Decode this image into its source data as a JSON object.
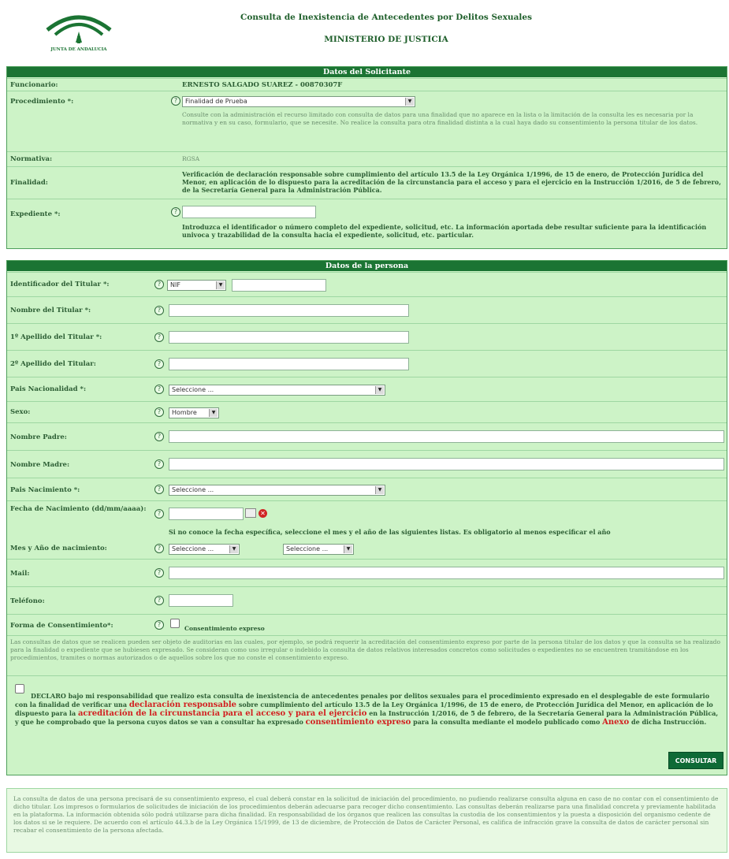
{
  "header": {
    "logo_text": "JUNTA DE ANDALUCIA",
    "title": "Consulta de Inexistencia de Antecedentes por Delitos Sexuales",
    "subtitle": "MINISTERIO DE JUSTICIA"
  },
  "solicitante": {
    "heading": "Datos del Solicitante",
    "funcionario_label": "Funcionario:",
    "funcionario_value": "ERNESTO SALGADO SUAREZ - 00870307F",
    "procedimiento_label": "Procedimiento *:",
    "procedimiento_value": "Finalidad de Prueba",
    "procedimiento_note": "Consulte con la administración el recurso limitado con consulta de datos para una finalidad que no aparece en la lista o la limitación de la consulta les es necesaria por la normativa y en su caso, formulario, que se necesite. No realice la consulta para otra finalidad distinta a la cual haya dado su consentimiento la persona titular de los datos.",
    "normativa_label": "Normativa:",
    "normativa_value": "RGSA",
    "finalidad_label": "Finalidad:",
    "finalidad_value": "Verificación de declaración responsable sobre cumplimiento del artículo 13.5 de la Ley Orgánica 1/1996, de 15 de enero, de Protección Jurídica del Menor, en aplicación de lo dispuesto para la acreditación de la circunstancia para el acceso y para el ejercicio en la Instrucción 1/2016, de 5 de febrero, de la Secretaría General para la Administración Pública.",
    "expediente_label": "Expediente *:",
    "expediente_value": "",
    "expediente_note": "Introduzca el identificador o número completo del expediente, solicitud, etc. La información aportada debe resultar suficiente para la identificación univoca y trazabilidad de la consulta hacia el expediente, solicitud, etc. particular."
  },
  "persona": {
    "heading": "Datos de la persona",
    "id_label": "Identificador del Titular *:",
    "id_type": "NIF",
    "nombre_label": "Nombre del Titular *:",
    "apellido1_label": "1º Apellido del Titular *:",
    "apellido2_label": "2º Apellido del Titular:",
    "pais_nac_label": "Pais Nacionalidad *:",
    "pais_nac_value": "Seleccione ...",
    "sexo_label": "Sexo:",
    "sexo_value": "Hombre",
    "padre_label": "Nombre Padre:",
    "madre_label": "Nombre Madre:",
    "pais_naci_label": "Pais Nacimiento *:",
    "pais_naci_value": "Seleccione ...",
    "fecha_label": "Fecha de Nacimiento (dd/mm/aaaa):",
    "fecha_note": "Si no conoce la fecha específica, seleccione el mes y el año de las siguientes listas. Es obligatorio al menos especificar el año",
    "mes_label": "Mes y Año de nacimiento:",
    "mes_value": "Seleccione ...",
    "anio_value": "Seleccione ...",
    "mail_label": "Mail:",
    "telefono_label": "Teléfono:",
    "forma_label": "Forma de Consentimiento*:",
    "forma_option": "Consentimiento expreso",
    "audit_note": "Las consultas de datos que se realicen pueden ser objeto de auditorias en las cuales, por ejemplo, se podrá requerir la acreditación del consentimiento expreso por parte de la persona titular de los datos y que la consulta se ha realizado para la finalidad o expediente que se hubiesen expresado. Se consideran como uso irregular o indebido la consulta de datos relativos interesados concretos como solicitudes o expedientes no se encuentren tramitándose en los procedimientos, tramites o normas autorizados o de aquellos sobre los que no conste el consentimiento expreso.",
    "declaro_pre": "DECLARO bajo mi responsabilidad que realizo esta consulta de inexistencia de antecedentes penales por delitos sexuales para el procedimiento expresado en el desplegable de este formulario con la finalidad de verificar una",
    "declaro_red1": "declaración responsable",
    "declaro_mid1": "sobre cumplimiento del artículo 13.5 de la Ley Orgánica 1/1996, de 15 de enero, de Protección Jurídica del Menor, en aplicación de lo dispuesto para la",
    "declaro_red2": "acreditación de la circunstancia para el acceso y para el ejercicio",
    "declaro_mid2": "en la Instrucción 1/2016, de 5 de febrero, de la Secretaría General para la Administración Pública, y que he comprobado que la persona cuyos datos se van a consultar ha expresado",
    "declaro_red3": "consentimiento expreso",
    "declaro_mid3": "para la consulta mediante el modelo publicado como",
    "declaro_red4": "Anexo",
    "declaro_end": "de dicha Instrucción.",
    "submit_label": "CONSULTAR"
  },
  "footer": {
    "text": "La consulta de datos de una persona precisará de su consentimiento expreso, el cual deberá constar en la solicitud de iniciación del procedimiento, no pudiendo realizarse consulta alguna en caso de no contar con el consentimiento de dicho titular. Los impresos o formularios de solicitudes de iniciación de los procedimientos deberán adecuarse para recoger dicho consentimiento. Las consultas deberán realizarse para una finalidad concreta y previamente habilitada en la plataforma. La información obtenida sólo podrá utilizarse para dicha finalidad. En responsabilidad de los órganos que realicen las consultas la custodia de los consentimientos y la puesta a disposición del organismo cedente de los datos si se le requiere. De acuerdo con el artículo 44.3.b de la Ley Orgánica 15/1999, de 13 de diciembre, de Protección de Datos de Carácter Personal, es califica de infracción grave la consulta de datos de carácter personal sin recabar el consentimiento de la persona afectada."
  }
}
